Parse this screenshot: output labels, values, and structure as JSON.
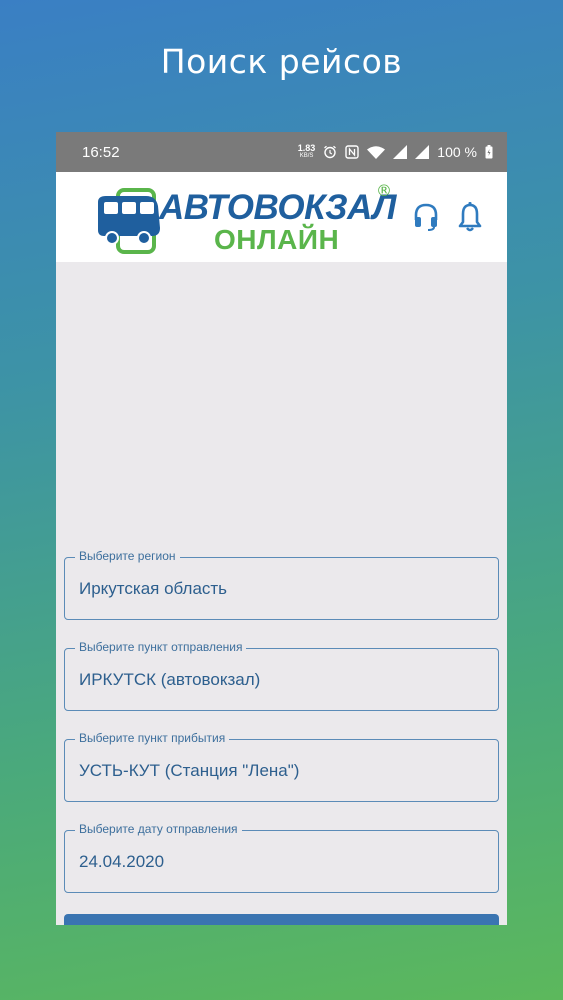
{
  "promo": {
    "title": "Поиск рейсов"
  },
  "statusbar": {
    "time": "16:52",
    "speed_value": "1.83",
    "speed_unit": "KB/S",
    "battery": "100 %",
    "icons": [
      "alarm-icon",
      "nfc-icon",
      "wifi-icon",
      "signal-icon",
      "signal-icon",
      "battery-icon"
    ]
  },
  "header": {
    "logo_top": "АВТОВОКЗАЛ",
    "logo_bottom": "ОНЛАЙН",
    "logo_reg": "®",
    "actions": [
      "headset-icon",
      "bell-icon"
    ]
  },
  "form": {
    "region": {
      "label": "Выберите регион",
      "value": "Иркутская область"
    },
    "departure": {
      "label": "Выберите пункт отправления",
      "value": "ИРКУТСК (автовокзал)"
    },
    "arrival": {
      "label": "Выберите пункт прибытия",
      "value": "УСТЬ-КУТ (Станция \"Лена\")"
    },
    "date": {
      "label": "Выберите дату отправления",
      "value": "24.04.2020"
    }
  },
  "colors": {
    "brand_blue": "#1f5f9e",
    "brand_green": "#5ab54b",
    "field_border": "#5b8bb7",
    "button": "#3a74b1"
  }
}
